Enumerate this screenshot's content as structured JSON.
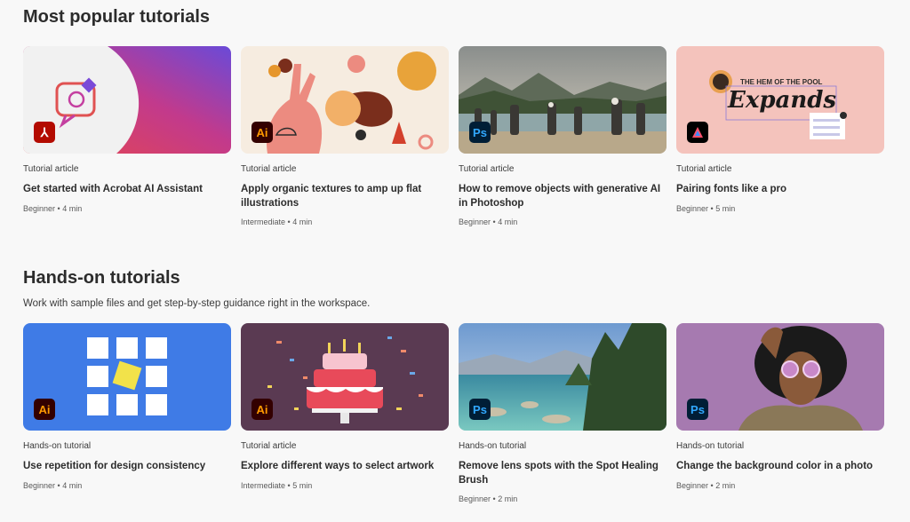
{
  "popular": {
    "title": "Most popular tutorials",
    "cards": [
      {
        "type": "Tutorial article",
        "title": "Get started with Acrobat AI Assistant",
        "level": "Beginner",
        "duration": "4 min",
        "app": "Acrobat",
        "app_icon": "acrobat-icon"
      },
      {
        "type": "Tutorial article",
        "title": "Apply organic textures to amp up flat illustrations",
        "level": "Intermediate",
        "duration": "4 min",
        "app": "Ai",
        "app_icon": "illustrator-icon"
      },
      {
        "type": "Tutorial article",
        "title": "How to remove objects with generative AI in Photoshop",
        "level": "Beginner",
        "duration": "4 min",
        "app": "Ps",
        "app_icon": "photoshop-icon"
      },
      {
        "type": "Tutorial article",
        "title": "Pairing fonts like a pro",
        "level": "Beginner",
        "duration": "5 min",
        "app": "Express",
        "app_icon": "express-icon",
        "thumb_text": {
          "heading": "THE HEM OF THE POOL",
          "word": "Expands"
        }
      }
    ]
  },
  "handson": {
    "title": "Hands-on tutorials",
    "subtitle": "Work with sample files and get step-by-step guidance right in the workspace.",
    "cards": [
      {
        "type": "Hands-on tutorial",
        "title": "Use repetition for design consistency",
        "level": "Beginner",
        "duration": "4 min",
        "app": "Ai",
        "app_icon": "illustrator-icon"
      },
      {
        "type": "Tutorial article",
        "title": "Explore different ways to select artwork",
        "level": "Intermediate",
        "duration": "5 min",
        "app": "Ai",
        "app_icon": "illustrator-icon"
      },
      {
        "type": "Hands-on tutorial",
        "title": "Remove lens spots with the Spot Healing Brush",
        "level": "Beginner",
        "duration": "2 min",
        "app": "Ps",
        "app_icon": "photoshop-icon"
      },
      {
        "type": "Hands-on tutorial",
        "title": "Change the background color in a photo",
        "level": "Beginner",
        "duration": "2 min",
        "app": "Ps",
        "app_icon": "photoshop-icon"
      }
    ]
  },
  "meta_separator": "•",
  "colors": {
    "acrobat": "#b30b00",
    "illustrator_bg": "#330000",
    "illustrator_fg": "#ff9a00",
    "photoshop_bg": "#001e36",
    "photoshop_fg": "#31a8ff"
  }
}
